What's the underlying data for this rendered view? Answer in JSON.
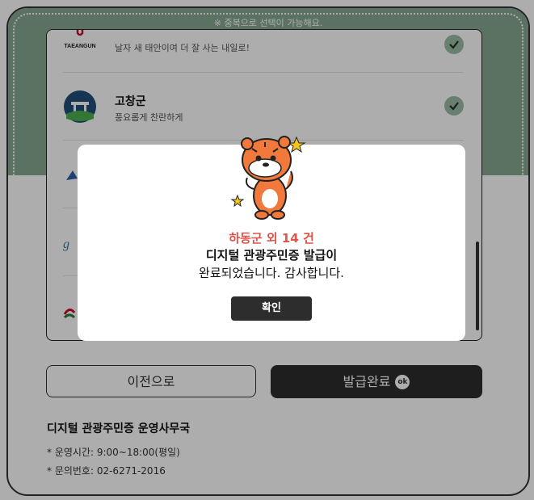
{
  "top_note": "※ 중복으로 선택이 가능해요.",
  "list": [
    {
      "name": "",
      "desc": "날자 새 태안이여 더 잘 사는 내일로!",
      "logo_label": "TAEANGUN",
      "logo_icon": "taean-logo-icon",
      "checked": true
    },
    {
      "name": "고창군",
      "desc": "풍요롭게 찬란하게",
      "logo_icon": "gochang-logo-icon",
      "checked": true
    },
    {
      "name": "",
      "desc": "",
      "logo_icon": "county-logo-icon",
      "checked": true
    },
    {
      "name": "",
      "desc": "",
      "logo_icon": "county-logo-icon",
      "checked": true
    },
    {
      "name": "",
      "desc": "",
      "logo_icon": "county-logo-icon",
      "checked": true
    }
  ],
  "buttons": {
    "prev": "이전으로",
    "done": "발급완료",
    "done_badge": "ok"
  },
  "footer": {
    "office": "디지털 관광주민증 운영사무국",
    "hours": "* 운영시간: 9:00~18:00(평일)",
    "phone": "* 문의번호: 02-6271-2016"
  },
  "modal": {
    "line1": "하동군 외 14 건",
    "line2": "디지털 관광주민증 발급이",
    "line3": "완료되었습니다. 감사합니다.",
    "confirm": "확인",
    "mascot_icon": "tiger-mascot-icon"
  },
  "colors": {
    "header_green": "#86a892",
    "check_green": "#9bbda6",
    "accent_red": "#e0534a",
    "dark_button": "#2d2d2d"
  }
}
